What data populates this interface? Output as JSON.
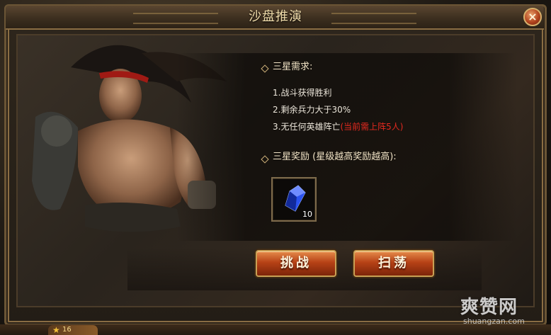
{
  "dialog": {
    "title": "沙盘推演",
    "close_label": "×"
  },
  "requirements": {
    "heading": "三星需求:",
    "items": [
      "1.战斗获得胜利",
      "2.剩余兵力大于30%",
      "3.无任何英雄阵亡"
    ],
    "note": "(当前需上阵5人)"
  },
  "rewards": {
    "heading": "三星奖励 (星级越高奖励越高):",
    "items": [
      {
        "icon": "blue-crystal-icon",
        "count": "10"
      }
    ]
  },
  "actions": {
    "challenge_label": "挑战",
    "sweep_label": "扫荡"
  },
  "footer": {
    "level": "16"
  },
  "watermark": {
    "brand": "爽赞网",
    "url": "shuangzan.com"
  },
  "colors": {
    "accent_red": "#e3291f",
    "frame_gold": "#8a6d43",
    "button_orange": "#b74216"
  }
}
